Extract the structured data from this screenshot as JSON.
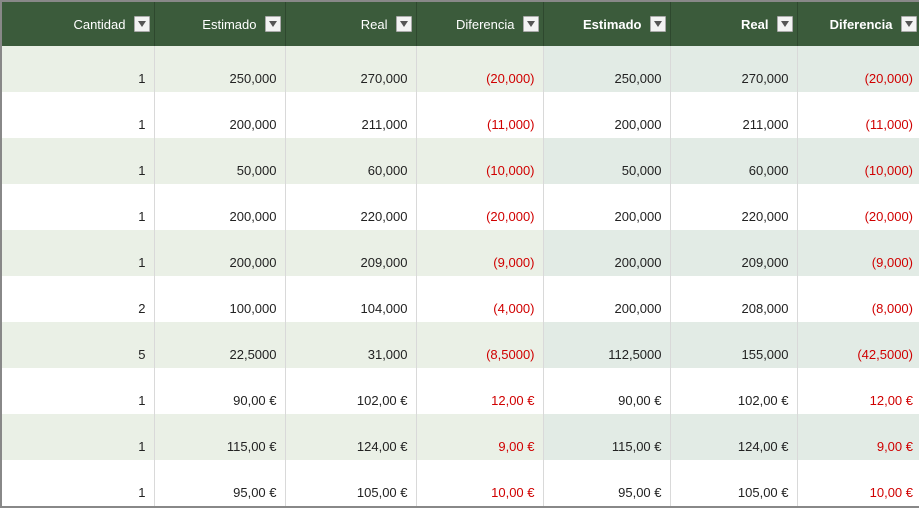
{
  "headers": {
    "qty": "Cantidad",
    "est_a": "Estimado",
    "real_a": "Real",
    "diff_a": "Diferencia",
    "est_b": "Estimado",
    "real_b": "Real",
    "diff_b": "Diferencia"
  },
  "rows": [
    {
      "qty": "1",
      "est_a": "250,000",
      "real_a": "270,000",
      "diff_a": "(20,000)",
      "est_b": "250,000",
      "real_b": "270,000",
      "diff_b": "(20,000)"
    },
    {
      "qty": "1",
      "est_a": "200,000",
      "real_a": "211,000",
      "diff_a": "(11,000)",
      "est_b": "200,000",
      "real_b": "211,000",
      "diff_b": "(11,000)"
    },
    {
      "qty": "1",
      "est_a": "50,000",
      "real_a": "60,000",
      "diff_a": "(10,000)",
      "est_b": "50,000",
      "real_b": "60,000",
      "diff_b": "(10,000)"
    },
    {
      "qty": "1",
      "est_a": "200,000",
      "real_a": "220,000",
      "diff_a": "(20,000)",
      "est_b": "200,000",
      "real_b": "220,000",
      "diff_b": "(20,000)"
    },
    {
      "qty": "1",
      "est_a": "200,000",
      "real_a": "209,000",
      "diff_a": "(9,000)",
      "est_b": "200,000",
      "real_b": "209,000",
      "diff_b": "(9,000)"
    },
    {
      "qty": "2",
      "est_a": "100,000",
      "real_a": "104,000",
      "diff_a": "(4,000)",
      "est_b": "200,000",
      "real_b": "208,000",
      "diff_b": "(8,000)"
    },
    {
      "qty": "5",
      "est_a": "22,5000",
      "real_a": "31,000",
      "diff_a": "(8,5000)",
      "est_b": "112,5000",
      "real_b": "155,000",
      "diff_b": "(42,5000)"
    },
    {
      "qty": "1",
      "est_a": "90,00 €",
      "real_a": "102,00 €",
      "diff_a": "12,00 €",
      "est_b": "90,00 €",
      "real_b": "102,00 €",
      "diff_b": "12,00 €"
    },
    {
      "qty": "1",
      "est_a": "115,00 €",
      "real_a": "124,00 €",
      "diff_a": "9,00 €",
      "est_b": "115,00 €",
      "real_b": "124,00 €",
      "diff_b": "9,00 €"
    },
    {
      "qty": "1",
      "est_a": "95,00 €",
      "real_a": "105,00 €",
      "diff_a": "10,00 €",
      "est_b": "95,00 €",
      "real_b": "105,00 €",
      "diff_b": "10,00 €"
    }
  ]
}
